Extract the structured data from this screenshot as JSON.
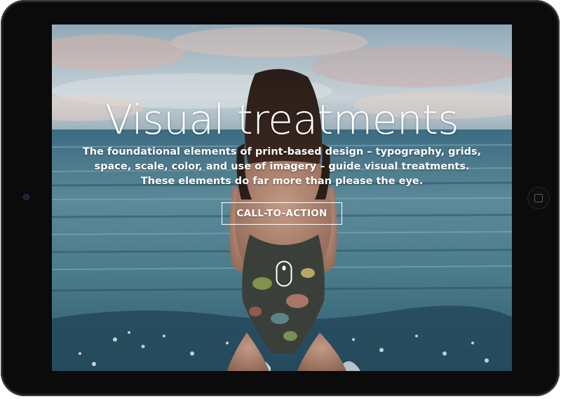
{
  "hero": {
    "title": "Visual treatments",
    "subtitle": "The foundational elements of print-based design – typography, grids, space, scale, color, and use of imagery – guide visual treatments. These elements do far more than please the eye.",
    "cta_label": "CALL-TO-ACTION"
  },
  "icons": {
    "scroll": "mouse-scroll-icon",
    "home": "home-button-icon",
    "camera": "front-camera-icon"
  },
  "colors": {
    "bezel": "#0b0b0c",
    "text": "#ffffff",
    "sea": "#3f6e80",
    "sky": "#c3d0d6"
  }
}
